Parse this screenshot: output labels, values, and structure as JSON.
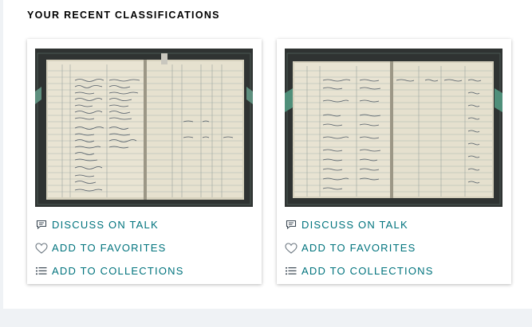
{
  "section": {
    "title": "YOUR RECENT CLASSIFICATIONS"
  },
  "cards": [
    {
      "image_alt": "Ledger page spread with handwritten entries",
      "actions": {
        "talk_label": "DISCUSS ON TALK",
        "talk_icon": "speech-bubble-icon",
        "favorites_label": "ADD TO FAVORITES",
        "favorites_icon": "heart-outline-icon",
        "collections_label": "ADD TO COLLECTIONS",
        "collections_icon": "list-icon"
      }
    },
    {
      "image_alt": "Ledger page spread with handwritten entries",
      "actions": {
        "talk_label": "DISCUSS ON TALK",
        "talk_icon": "speech-bubble-icon",
        "favorites_label": "ADD TO FAVORITES",
        "favorites_icon": "heart-outline-icon",
        "collections_label": "ADD TO COLLECTIONS",
        "collections_icon": "list-icon"
      }
    }
  ],
  "colors": {
    "accent": "#00737d",
    "page_bg": "#eff2f5",
    "panel_bg": "#ffffff"
  }
}
